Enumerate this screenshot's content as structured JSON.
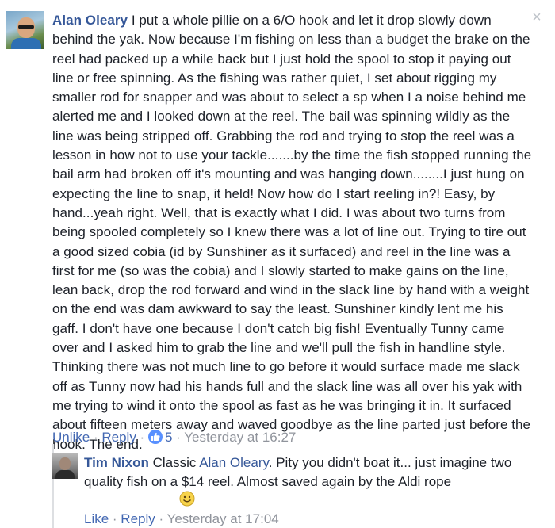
{
  "header_fragment": "",
  "comment": {
    "author": "Alan Oleary",
    "text": "I put a whole pillie on a 6/O hook and let it drop slowly down behind the yak. Now because I'm fishing on less than a budget the brake on the reel had packed up a while back but I just hold the spool to stop it paying out line or free spinning. As the fishing was rather quiet, I set about rigging my smaller rod for snapper and was about to select a sp when I a noise behind me alerted me and I looked down at the reel. The bail was spinning wildly as the line was being stripped off. Grabbing the rod and trying to stop the reel was a lesson in how not to use your tackle.......by the time the fish stopped running the bail arm had broken off it's mounting and was hanging down........I just hung on expecting the line to snap, it held! Now how do I start reeling in?! Easy, by hand...yeah right. Well, that is exactly what I did. I was about two turns from being spooled completely so I knew there was a lot of line out. Trying to tire out a good sized cobia (id by Sunshiner as it surfaced) and reel in the line was a first for me (so was the cobia) and I slowly started to make gains on the line, lean back, drop the rod forward and wind in the slack line by hand with a weight on the end was dam awkward to say the least. Sunshiner kindly lent me his gaff. I don't have one because I don't catch big fish! Eventually Tunny came over and I asked him to grab the line and we'll pull the fish in handline style. Thinking there was not much line to go before it would surface made me slack off as Tunny now had his hands full and the slack line was all over his yak with me trying to wind it onto the spool as fast as he was bringing it in. It surfaced about fifteen meters away and waved goodbye as the line parted just before the hook. The end.",
    "close_icon": "×",
    "actions": {
      "unlike": "Unlike",
      "sep1": " · ",
      "reply": "Reply",
      "sep2": " · ",
      "like_count": "5",
      "sep3": " · ",
      "timestamp": "Yesterday at 16:27"
    },
    "like_icon_color": "#5890ff"
  },
  "reply": {
    "author": "Tim Nixon",
    "text_before": "Classic ",
    "mention": "Alan Oleary",
    "text_after": ". Pity you didn't boat it... just imagine two quality fish on a $14 reel. Almost saved again by the Aldi rope",
    "emoji": "smiling-face",
    "actions": {
      "like": "Like",
      "sep1": " · ",
      "reply": "Reply",
      "sep2": " · ",
      "timestamp": "Yesterday at 17:04"
    }
  },
  "colors": {
    "link_blue": "#365899",
    "action_blue": "#4267b2",
    "meta_gray": "#90949c",
    "text": "#1d2129"
  }
}
